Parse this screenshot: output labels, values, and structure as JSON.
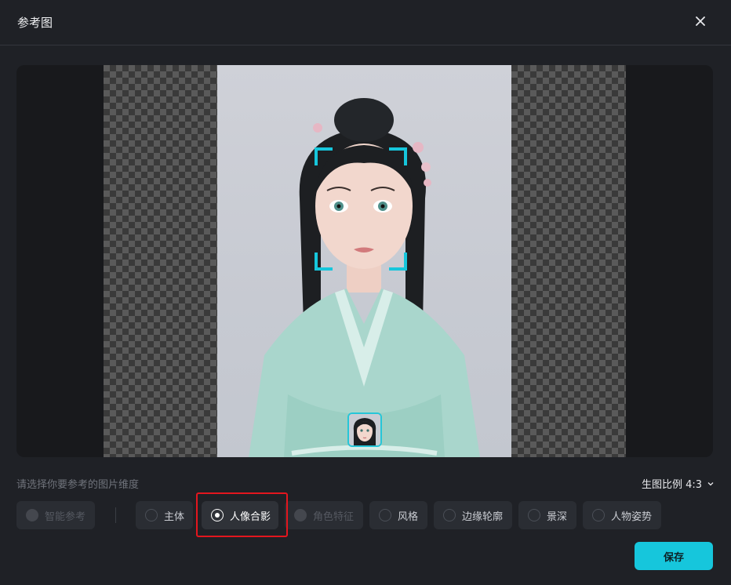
{
  "dialog": {
    "title": "参考图",
    "close_icon": "close-icon"
  },
  "hint": "请选择你要参考的图片维度",
  "ratio": {
    "label": "生图比例 4:3",
    "icon": "chevron-down-icon"
  },
  "options": [
    {
      "label": "智能参考",
      "state": "disabled"
    },
    {
      "label": "主体",
      "state": "unselected"
    },
    {
      "label": "人像合影",
      "state": "selected"
    },
    {
      "label": "角色特征",
      "state": "disabled"
    },
    {
      "label": "风格",
      "state": "unselected"
    },
    {
      "label": "边缘轮廓",
      "state": "unselected"
    },
    {
      "label": "景深",
      "state": "unselected"
    },
    {
      "label": "人物姿势",
      "state": "unselected"
    }
  ],
  "save_label": "保存",
  "colors": {
    "accent": "#16c6dc",
    "highlight": "#e3161e",
    "background": "#1f2126"
  }
}
